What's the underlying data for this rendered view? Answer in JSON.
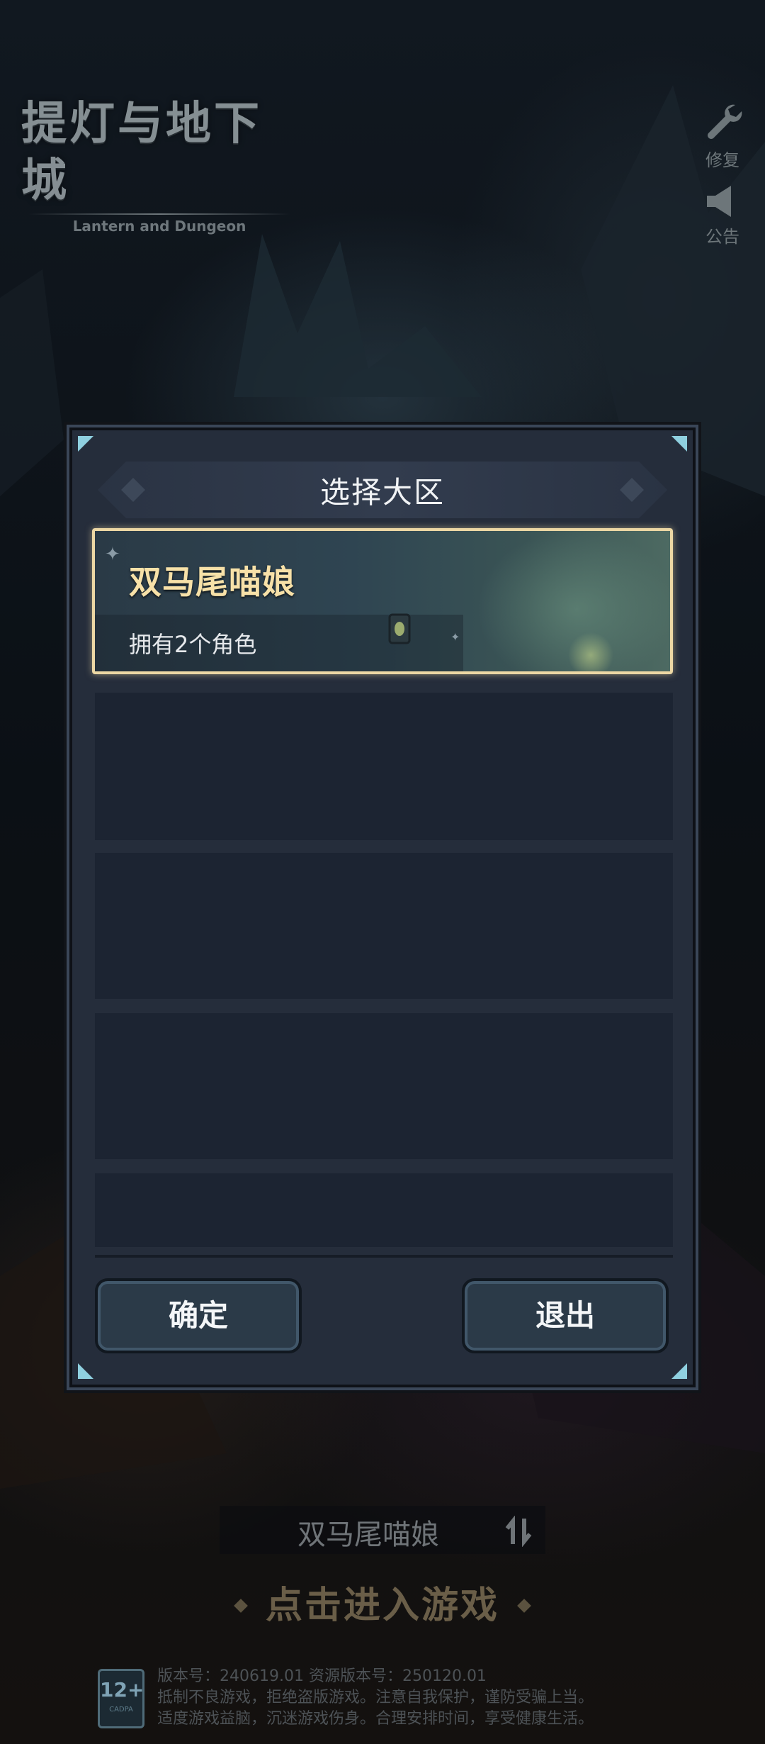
{
  "logo": {
    "title": "提灯与地下城",
    "subtitle": "Lantern and Dungeon"
  },
  "tools": {
    "repair_label": "修复",
    "notice_label": "公告"
  },
  "dialog": {
    "title": "选择大区",
    "selected_server": {
      "name": "双马尾喵娘",
      "subtitle": "拥有2个角色"
    },
    "confirm_label": "确定",
    "exit_label": "退出"
  },
  "bottom": {
    "current_server": "双马尾喵娘",
    "enter_game": "点击进入游戏",
    "age_rating": "12+",
    "age_rating_sub": "CADPA",
    "version_line": "版本号：240619.01  资源版本号：250120.01",
    "notice_line1": "抵制不良游戏，拒绝盗版游戏。注意自我保护，谨防受骗上当。",
    "notice_line2": "适度游戏益脑，沉迷游戏伤身。合理安排时间，享受健康生活。"
  },
  "colors": {
    "card_border": "#ecd7a4",
    "card_name": "#f7e1a8",
    "corner_accent": "#8fd0e0"
  }
}
